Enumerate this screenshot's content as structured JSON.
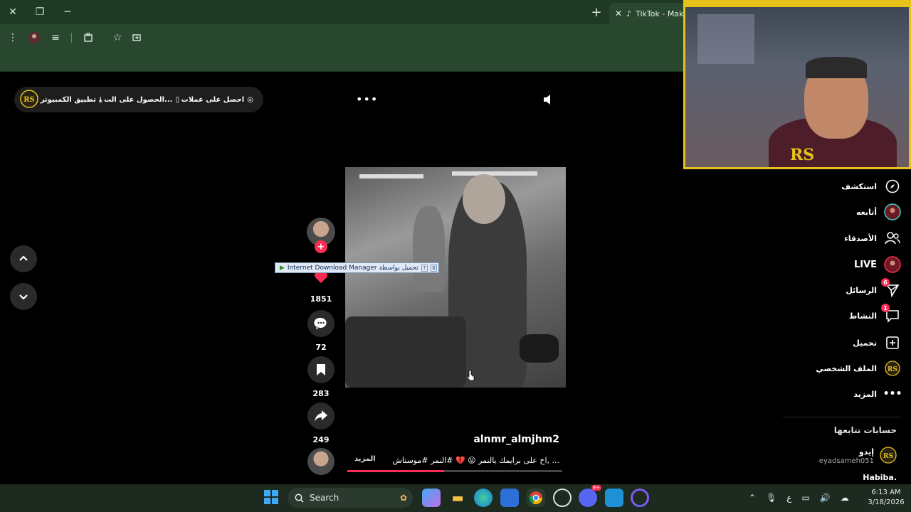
{
  "browser": {
    "tab_title": "TikTok - Make",
    "titlebar_buttons": [
      "close",
      "restore",
      "minimize"
    ],
    "new_tab_label": "+"
  },
  "tiktok": {
    "top_pill": {
      "desktop_app": "تطبيق الكمبيوتر",
      "get_app": "الحصول على الت...",
      "get_coins": "احصل على عملات"
    },
    "more_dots": "•••",
    "actions": {
      "likes": "1851",
      "comments": "72",
      "saves": "283",
      "shares": "249"
    },
    "idm_bar": "Internet Download Manager تحميل بواسطة",
    "idm_help": "?",
    "idm_close": "X",
    "post": {
      "username": "alnmr_almjhm2",
      "caption": "اخ على برايمك يالنمر 😝 💔 #النمر #موستاش, ...",
      "more_label": "المزيد",
      "progress": 0.45
    },
    "sidebar": {
      "items": [
        {
          "label": "استكشف",
          "icon": "compass-icon"
        },
        {
          "label": "أتابعه",
          "icon": "following-avatar-icon"
        },
        {
          "label": "الأصدقاء",
          "icon": "friends-icon"
        },
        {
          "label": "LIVE",
          "icon": "live-icon"
        },
        {
          "label": "الرسائل",
          "icon": "messages-icon",
          "badge": "6"
        },
        {
          "label": "النشاط",
          "icon": "activity-icon",
          "badge": "1"
        },
        {
          "label": "تحميل",
          "icon": "upload-icon"
        },
        {
          "label": "الملف الشخصي",
          "icon": "profile-avatar-icon"
        },
        {
          "label": "المزيد",
          "icon": "more-icon"
        }
      ],
      "following_title": "حسابات تتابعها",
      "accounts": [
        {
          "name": "إيدو",
          "handle": "eyadsameh051"
        },
        {
          "name": "Habiba."
        }
      ]
    }
  },
  "webcam": {
    "logo": "RS"
  },
  "taskbar": {
    "search_label": "Search",
    "tray_lang": "ع",
    "time": "6:13 AM",
    "date": "3/18/2026",
    "discord_badge": "9+"
  },
  "colors": {
    "tiktok_red": "#fe2c55",
    "chrome_green": "#29472e",
    "webcam_border": "#e6c21a"
  }
}
